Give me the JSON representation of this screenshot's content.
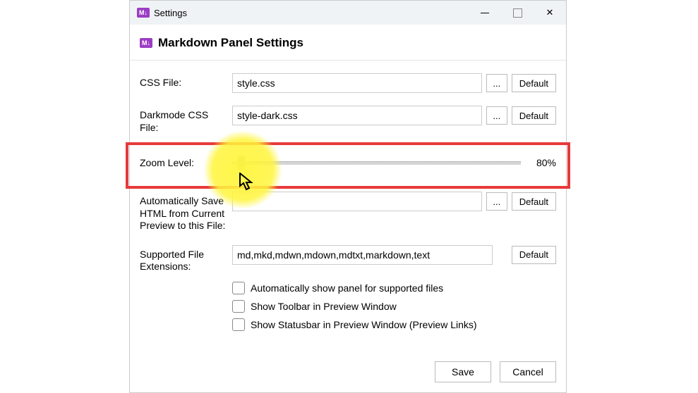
{
  "window": {
    "title": "Settings",
    "app_icon_text": "M↓"
  },
  "header": {
    "icon_text": "M↓",
    "title": "Markdown Panel Settings"
  },
  "rows": {
    "css_file": {
      "label": "CSS File:",
      "value": "style.css",
      "ellipsis": "...",
      "default": "Default"
    },
    "dark_css": {
      "label": "Darkmode CSS File:",
      "value": "style-dark.css",
      "ellipsis": "...",
      "default": "Default"
    },
    "zoom": {
      "label": "Zoom Level:",
      "value_text": "80%"
    },
    "autosave": {
      "label": "Automatically Save HTML from Current Preview to this File:",
      "value": "",
      "ellipsis": "...",
      "default": "Default"
    },
    "ext": {
      "label": "Supported File Extensions:",
      "value": "md,mkd,mdwn,mdown,mdtxt,markdown,text",
      "default": "Default"
    }
  },
  "checks": {
    "auto_panel": "Automatically show panel for supported files",
    "toolbar": "Show Toolbar in Preview Window",
    "statusbar": "Show Statusbar in Preview Window (Preview Links)"
  },
  "footer": {
    "save": "Save",
    "cancel": "Cancel"
  }
}
